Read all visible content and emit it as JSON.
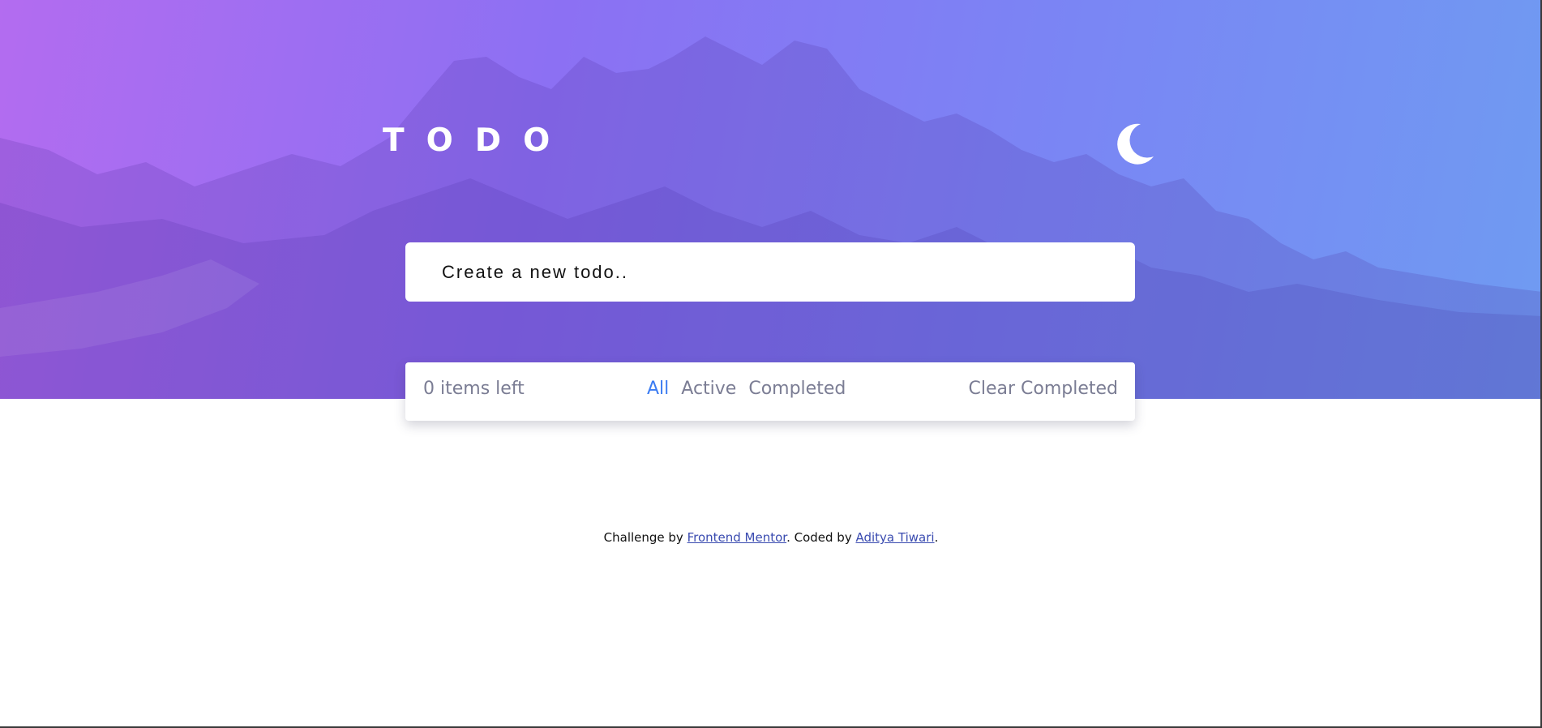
{
  "header": {
    "title": "TODO",
    "theme_toggle_icon": "moon-icon"
  },
  "new_todo": {
    "placeholder": "Create a new todo..",
    "value": ""
  },
  "footer_bar": {
    "items_left": "0 items left",
    "filters": [
      {
        "label": "All",
        "active": true
      },
      {
        "label": "Active",
        "active": false
      },
      {
        "label": "Completed",
        "active": false
      }
    ],
    "clear_label": "Clear Completed"
  },
  "attribution": {
    "prefix": "Challenge by ",
    "link1": "Frontend Mentor",
    "middle": ". Coded by ",
    "link2": "Aditya Tiwari",
    "suffix": "."
  },
  "colors": {
    "gradient_start": "#b36cf0",
    "gradient_end": "#6f9bf2",
    "active_filter": "#3b7cf2",
    "muted_text": "#7b7d94"
  }
}
